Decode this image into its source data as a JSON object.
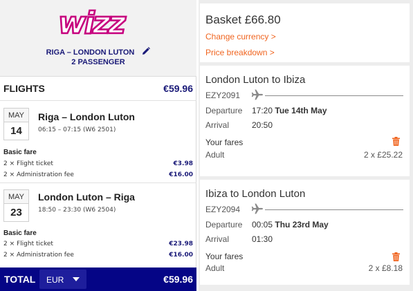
{
  "wizz": {
    "logo_text": "wizz",
    "route": "RIGA – LONDON LUTON",
    "passengers": "2 PASSENGER",
    "flights_header": "FLIGHTS",
    "flights_total": "€59.96",
    "legs": [
      {
        "month": "MAY",
        "day": "14",
        "route": "Riga – London Luton",
        "time": "06:15 – 07:15 (W6 2501)",
        "fare_type": "Basic fare",
        "items": [
          {
            "label": "2 × Flight ticket",
            "amount": "€3.98"
          },
          {
            "label": "2 × Administration fee",
            "amount": "€16.00"
          }
        ]
      },
      {
        "month": "MAY",
        "day": "23",
        "route": "London Luton – Riga",
        "time": "18:50 – 23:30 (W6 2504)",
        "fare_type": "Basic fare",
        "items": [
          {
            "label": "2 × Flight ticket",
            "amount": "€23.98"
          },
          {
            "label": "2 × Administration fee",
            "amount": "€16.00"
          }
        ]
      }
    ],
    "total_label": "TOTAL",
    "currency": "EUR",
    "total_amount": "€59.96",
    "colors": {
      "brand_navy": "#050586",
      "brand_magenta": "#c6007e",
      "text_navy": "#1a1a78"
    }
  },
  "easyjet": {
    "basket_title": "Basket £66.80",
    "change_currency": "Change currency >",
    "price_breakdown": "Price breakdown >",
    "flights": [
      {
        "title": "London Luton to Ibiza",
        "flight_no": "EZY2091",
        "departure_label": "Departure",
        "departure_time": "17:20",
        "departure_date": "Tue 14th May",
        "arrival_label": "Arrival",
        "arrival_time": "20:50",
        "fares_label": "Your fares",
        "passenger_type": "Adult",
        "price": "2 x £25.22"
      },
      {
        "title": "Ibiza to London Luton",
        "flight_no": "EZY2094",
        "departure_label": "Departure",
        "departure_time": "00:05",
        "departure_date": "Thu 23rd May",
        "arrival_label": "Arrival",
        "arrival_time": "01:30",
        "fares_label": "Your fares",
        "passenger_type": "Adult",
        "price": "2 x £8.18"
      }
    ],
    "colors": {
      "accent_orange": "#f06520",
      "panel_bg": "#ededed"
    }
  }
}
